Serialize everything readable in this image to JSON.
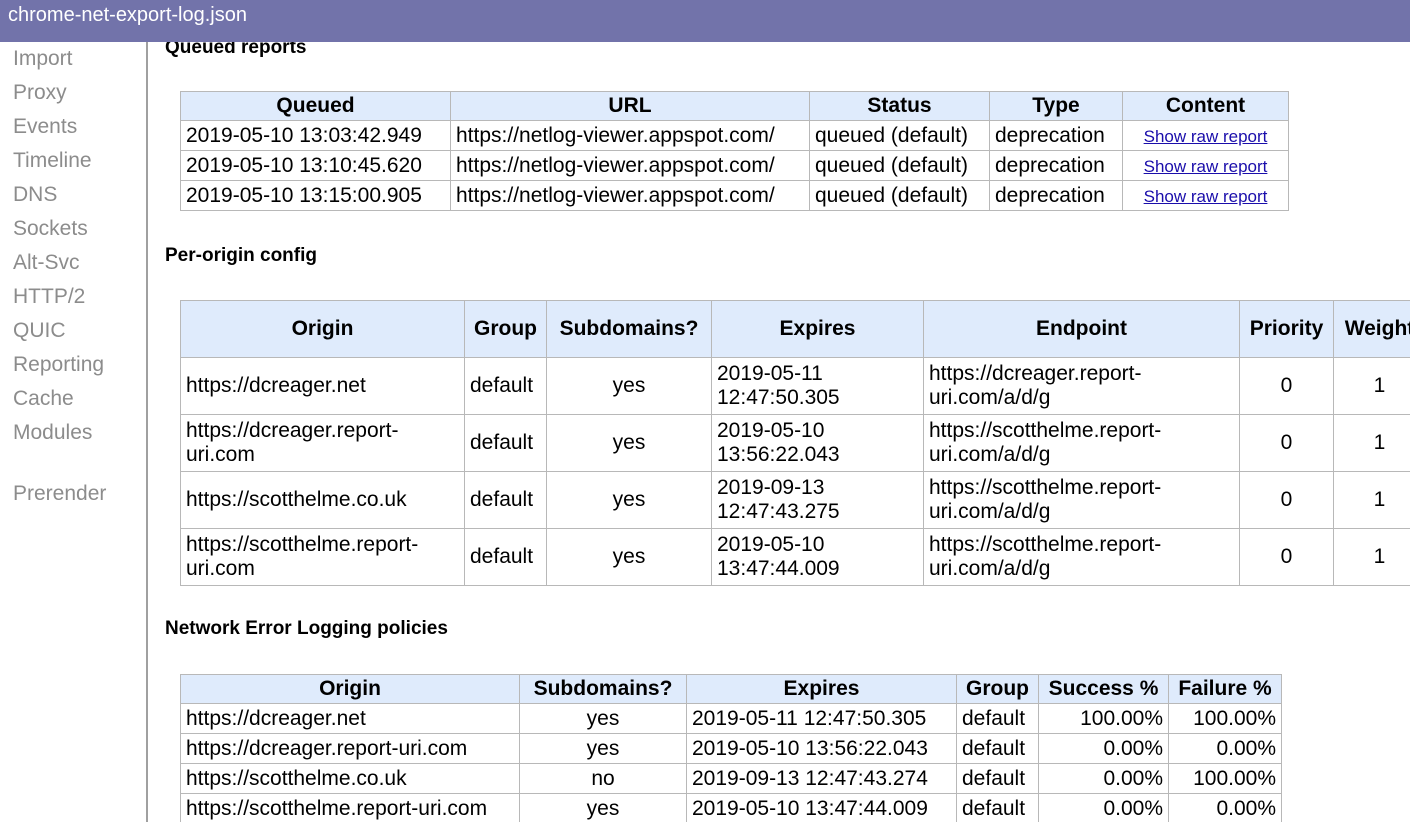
{
  "window": {
    "title": "chrome-net-export-log.json"
  },
  "sidebar": {
    "items": [
      {
        "label": "Import"
      },
      {
        "label": "Proxy"
      },
      {
        "label": "Events"
      },
      {
        "label": "Timeline"
      },
      {
        "label": "DNS"
      },
      {
        "label": "Sockets"
      },
      {
        "label": "Alt-Svc"
      },
      {
        "label": "HTTP/2"
      },
      {
        "label": "QUIC"
      },
      {
        "label": "Reporting"
      },
      {
        "label": "Cache"
      },
      {
        "label": "Modules"
      },
      {
        "label": "Prerender"
      }
    ]
  },
  "queued": {
    "heading": "Queued reports",
    "headers": [
      "Queued",
      "URL",
      "Status",
      "Type",
      "Content"
    ],
    "rows": [
      {
        "queued": "2019-05-10 13:03:42.949",
        "url": "https://netlog-viewer.appspot.com/",
        "status": "queued (default)",
        "type": "deprecation",
        "content": "Show raw report"
      },
      {
        "queued": "2019-05-10 13:10:45.620",
        "url": "https://netlog-viewer.appspot.com/",
        "status": "queued (default)",
        "type": "deprecation",
        "content": "Show raw report"
      },
      {
        "queued": "2019-05-10 13:15:00.905",
        "url": "https://netlog-viewer.appspot.com/",
        "status": "queued (default)",
        "type": "deprecation",
        "content": "Show raw report"
      }
    ]
  },
  "config": {
    "heading": "Per-origin config",
    "headers": [
      "Origin",
      "Group",
      "Subdomains?",
      "Expires",
      "Endpoint",
      "Priority",
      "Weight"
    ],
    "rows": [
      {
        "origin": "https://dcreager.net",
        "group": "default",
        "subdomains": "yes",
        "expires": "2019-05-11 12:47:50.305",
        "endpoint": "https://dcreager.report-uri.com/a/d/g",
        "priority": "0",
        "weight": "1"
      },
      {
        "origin": "https://dcreager.report-uri.com",
        "group": "default",
        "subdomains": "yes",
        "expires": "2019-05-10 13:56:22.043",
        "endpoint": "https://scotthelme.report-uri.com/a/d/g",
        "priority": "0",
        "weight": "1"
      },
      {
        "origin": "https://scotthelme.co.uk",
        "group": "default",
        "subdomains": "yes",
        "expires": "2019-09-13 12:47:43.275",
        "endpoint": "https://scotthelme.report-uri.com/a/d/g",
        "priority": "0",
        "weight": "1"
      },
      {
        "origin": "https://scotthelme.report-uri.com",
        "group": "default",
        "subdomains": "yes",
        "expires": "2019-05-10 13:47:44.009",
        "endpoint": "https://scotthelme.report-uri.com/a/d/g",
        "priority": "0",
        "weight": "1"
      }
    ]
  },
  "nel": {
    "heading": "Network Error Logging policies",
    "headers": [
      "Origin",
      "Subdomains?",
      "Expires",
      "Group",
      "Success %",
      "Failure %"
    ],
    "rows": [
      {
        "origin": "https://dcreager.net",
        "subdomains": "yes",
        "expires": "2019-05-11 12:47:50.305",
        "group": "default",
        "success": "100.00%",
        "failure": "100.00%"
      },
      {
        "origin": "https://dcreager.report-uri.com",
        "subdomains": "yes",
        "expires": "2019-05-10 13:56:22.043",
        "group": "default",
        "success": "0.00%",
        "failure": "0.00%"
      },
      {
        "origin": "https://scotthelme.co.uk",
        "subdomains": "no",
        "expires": "2019-09-13 12:47:43.274",
        "group": "default",
        "success": "0.00%",
        "failure": "100.00%"
      },
      {
        "origin": "https://scotthelme.report-uri.com",
        "subdomains": "yes",
        "expires": "2019-05-10 13:47:44.009",
        "group": "default",
        "success": "0.00%",
        "failure": "0.00%"
      }
    ]
  }
}
